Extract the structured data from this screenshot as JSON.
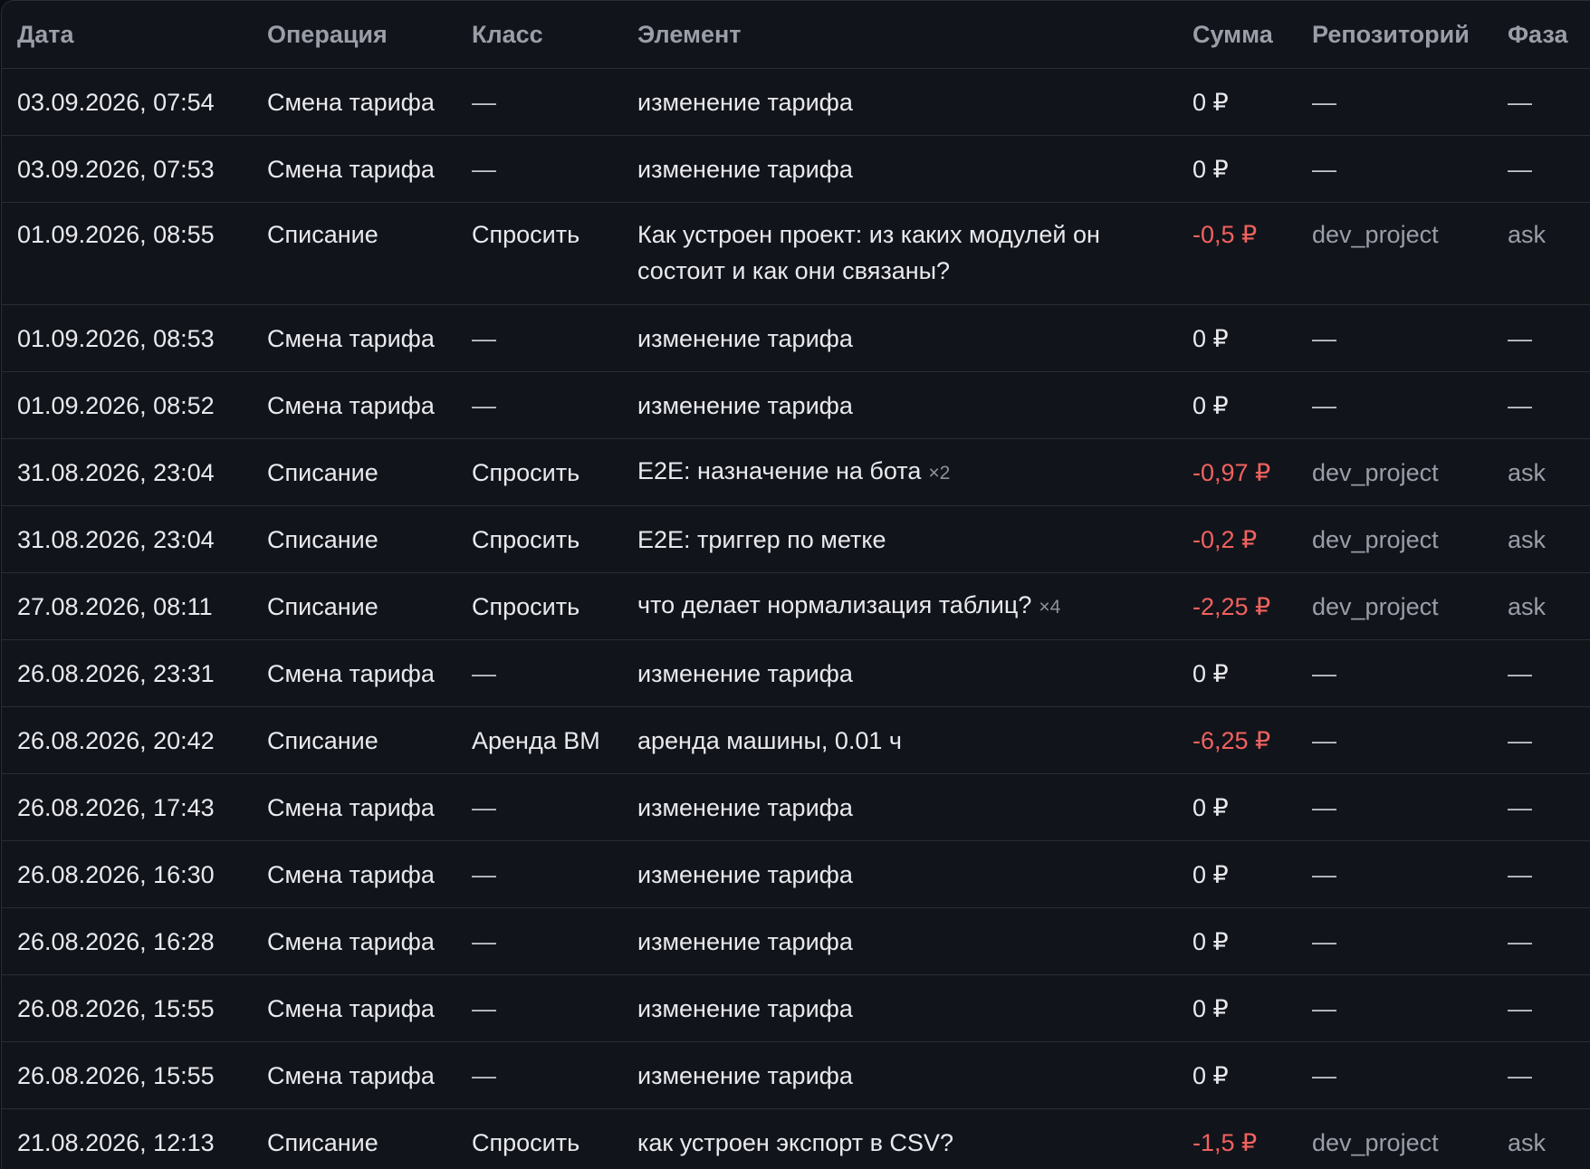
{
  "table": {
    "headers": [
      "Дата",
      "Операция",
      "Класс",
      "Элемент",
      "Сумма",
      "Репозиторий",
      "Фаза"
    ],
    "rows": [
      {
        "date": "03.09.2026, 07:54",
        "operation": "Смена тарифа",
        "class": "—",
        "element": "изменение тарифа",
        "multiplier": "",
        "amount": "0 ₽",
        "repo": "—",
        "phase": "—"
      },
      {
        "date": "03.09.2026, 07:53",
        "operation": "Смена тарифа",
        "class": "—",
        "element": "изменение тарифа",
        "multiplier": "",
        "amount": "0 ₽",
        "repo": "—",
        "phase": "—"
      },
      {
        "date": "01.09.2026, 08:55",
        "operation": "Списание",
        "class": "Спросить",
        "element": "Как устроен проект: из каких модулей он состоит и как они связаны?",
        "multiplier": "",
        "amount": "-0,5 ₽",
        "repo": "dev_project",
        "phase": "ask"
      },
      {
        "date": "01.09.2026, 08:53",
        "operation": "Смена тарифа",
        "class": "—",
        "element": "изменение тарифа",
        "multiplier": "",
        "amount": "0 ₽",
        "repo": "—",
        "phase": "—"
      },
      {
        "date": "01.09.2026, 08:52",
        "operation": "Смена тарифа",
        "class": "—",
        "element": "изменение тарифа",
        "multiplier": "",
        "amount": "0 ₽",
        "repo": "—",
        "phase": "—"
      },
      {
        "date": "31.08.2026, 23:04",
        "operation": "Списание",
        "class": "Спросить",
        "element": "E2E: назначение на бота",
        "multiplier": "×2",
        "amount": "-0,97 ₽",
        "repo": "dev_project",
        "phase": "ask"
      },
      {
        "date": "31.08.2026, 23:04",
        "operation": "Списание",
        "class": "Спросить",
        "element": "E2E: триггер по метке",
        "multiplier": "",
        "amount": "-0,2 ₽",
        "repo": "dev_project",
        "phase": "ask"
      },
      {
        "date": "27.08.2026, 08:11",
        "operation": "Списание",
        "class": "Спросить",
        "element": "что делает нормализация таблиц?",
        "multiplier": "×4",
        "amount": "-2,25 ₽",
        "repo": "dev_project",
        "phase": "ask"
      },
      {
        "date": "26.08.2026, 23:31",
        "operation": "Смена тарифа",
        "class": "—",
        "element": "изменение тарифа",
        "multiplier": "",
        "amount": "0 ₽",
        "repo": "—",
        "phase": "—"
      },
      {
        "date": "26.08.2026, 20:42",
        "operation": "Списание",
        "class": "Аренда ВМ",
        "element": "аренда машины, 0.01 ч",
        "multiplier": "",
        "amount": "-6,25 ₽",
        "repo": "—",
        "phase": "—"
      },
      {
        "date": "26.08.2026, 17:43",
        "operation": "Смена тарифа",
        "class": "—",
        "element": "изменение тарифа",
        "multiplier": "",
        "amount": "0 ₽",
        "repo": "—",
        "phase": "—"
      },
      {
        "date": "26.08.2026, 16:30",
        "operation": "Смена тарифа",
        "class": "—",
        "element": "изменение тарифа",
        "multiplier": "",
        "amount": "0 ₽",
        "repo": "—",
        "phase": "—"
      },
      {
        "date": "26.08.2026, 16:28",
        "operation": "Смена тарифа",
        "class": "—",
        "element": "изменение тарифа",
        "multiplier": "",
        "amount": "0 ₽",
        "repo": "—",
        "phase": "—"
      },
      {
        "date": "26.08.2026, 15:55",
        "operation": "Смена тарифа",
        "class": "—",
        "element": "изменение тарифа",
        "multiplier": "",
        "amount": "0 ₽",
        "repo": "—",
        "phase": "—"
      },
      {
        "date": "26.08.2026, 15:55",
        "operation": "Смена тарифа",
        "class": "—",
        "element": "изменение тарифа",
        "multiplier": "",
        "amount": "0 ₽",
        "repo": "—",
        "phase": "—"
      },
      {
        "date": "21.08.2026, 12:13",
        "operation": "Списание",
        "class": "Спросить",
        "element": "как устроен экспорт в CSV?",
        "multiplier": "",
        "amount": "-1,5 ₽",
        "repo": "dev_project",
        "phase": "ask"
      }
    ]
  },
  "colors": {
    "background": "#12141b",
    "text": "#e9eaee",
    "muted": "#9a9ea8",
    "negative": "#f0625e",
    "border": "#2a2d36"
  }
}
